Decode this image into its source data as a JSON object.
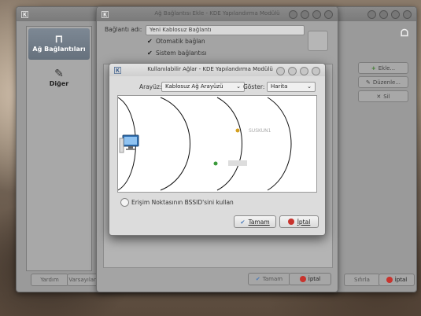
{
  "outer_window": {
    "sidebar": [
      {
        "label": "Ağ Bağlantıları",
        "icon": "network-icon"
      },
      {
        "label": "Diğer",
        "icon": "tools-icon"
      }
    ],
    "buttons": {
      "add": "Ekle...",
      "edit": "Düzenle...",
      "delete": "Sil"
    },
    "bottom": {
      "help": "Yardım",
      "defaults": "Varsayılanlar",
      "reset": "Sıfırla",
      "cancel": "İptal"
    }
  },
  "middle_window": {
    "title": "Ağ Bağlantısı Ekle - KDE Yapılandırma Modülü",
    "connection_name_label": "Bağlantı adı:",
    "connection_name_value": "Yeni Kablosuz Bağlantı",
    "auto_connect": "Otomatik bağlan",
    "system_connection": "Sistem bağlantısı",
    "ok": "Tamam",
    "cancel": "İptal"
  },
  "dialog": {
    "title": "Kullanılabilir Ağlar - KDE Yapılandırma Modülü",
    "interface_label": "Arayüz:",
    "interface_value": "Kablosuz Ağ Arayüzü",
    "show_label": "Göster:",
    "show_value": "Harita",
    "networks": [
      {
        "name": "SUSKUN1",
        "color": "#d4a020"
      },
      {
        "name": "",
        "color": "#3a9a3a"
      }
    ],
    "bssid_option": "Erişim Noktasının BSSID'sini kullan",
    "ok": "Tamam",
    "cancel": "İptal"
  }
}
